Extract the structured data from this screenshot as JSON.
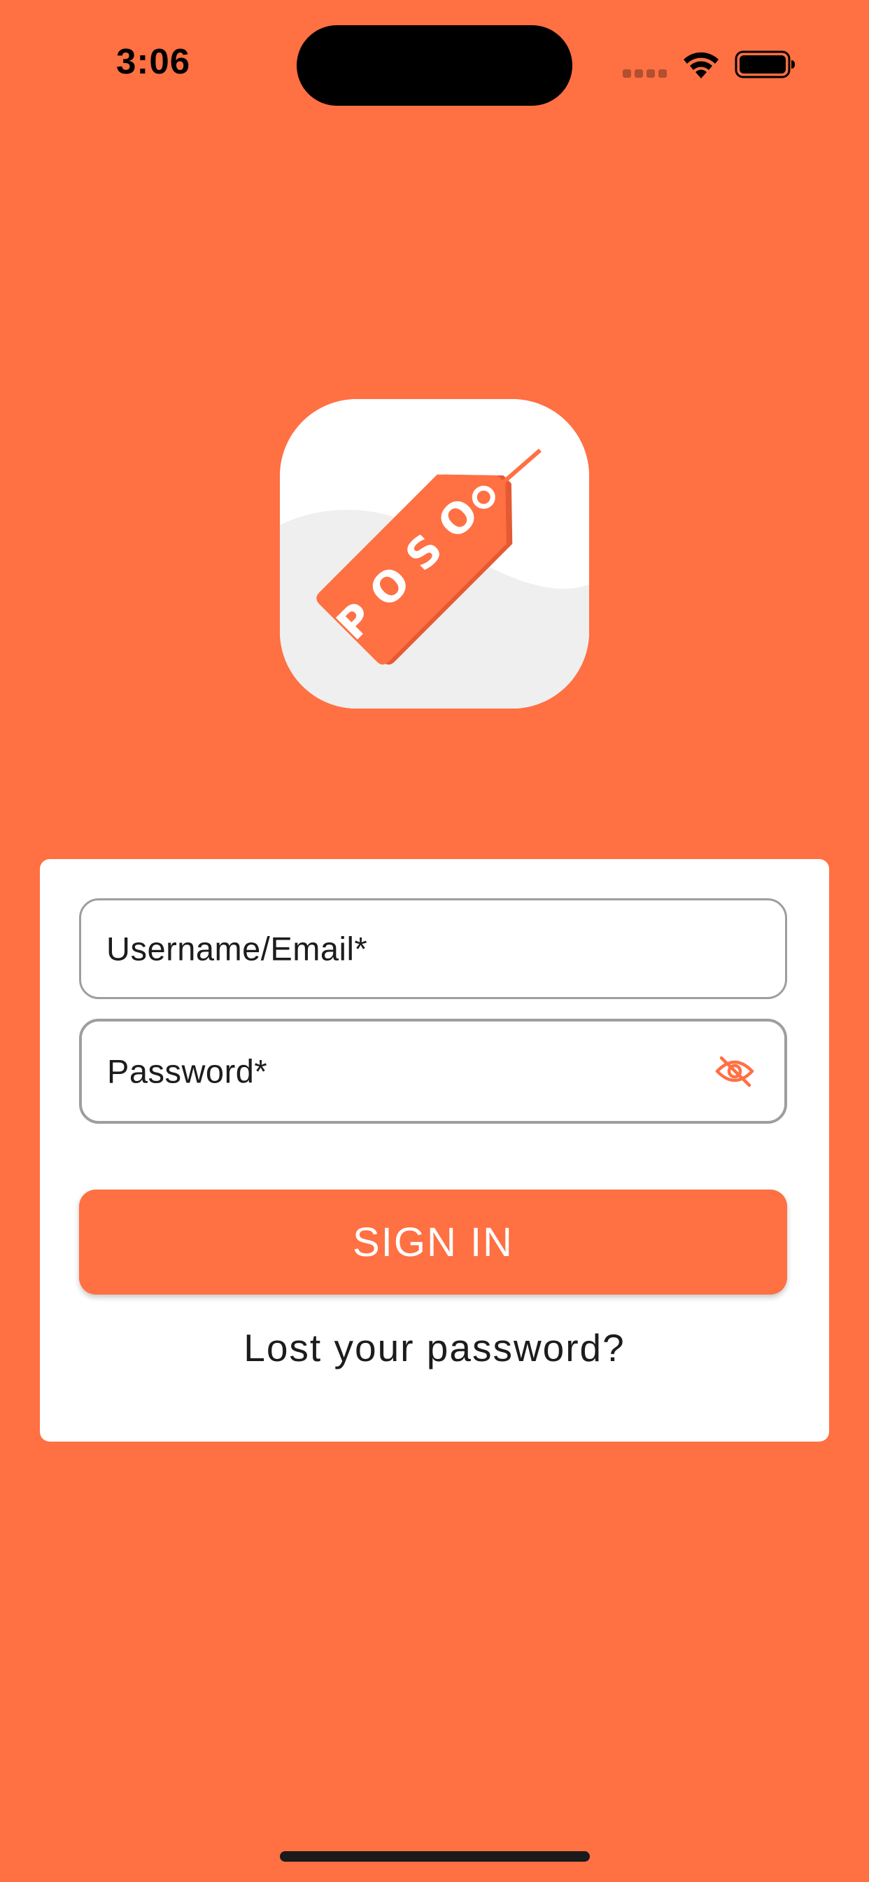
{
  "status_bar": {
    "time": "3:06"
  },
  "logo": {
    "text": "POSO",
    "brand_color": "#FF7043"
  },
  "form": {
    "username_label": "Username/Email*",
    "password_label": "Password*",
    "password_toggle_icon": "eye-off-icon",
    "signin_label": "SIGN IN",
    "lost_password_label": "Lost your password?"
  },
  "colors": {
    "background": "#FF7043",
    "card": "#FFFFFF",
    "field_border": "#9E9E9E",
    "text": "#1C1C1C"
  }
}
